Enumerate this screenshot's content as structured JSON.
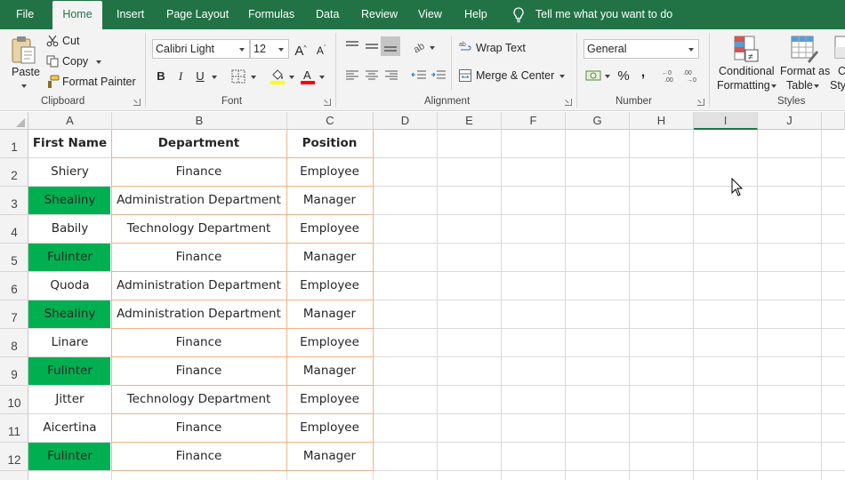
{
  "menu": {
    "tabs": [
      "File",
      "Home",
      "Insert",
      "Page Layout",
      "Formulas",
      "Data",
      "Review",
      "View",
      "Help"
    ],
    "active_tab": "Home",
    "tell_me": "Tell me what you want to do"
  },
  "ribbon": {
    "clipboard": {
      "paste": "Paste",
      "cut": "Cut",
      "copy": "Copy",
      "format_painter": "Format Painter",
      "label": "Clipboard"
    },
    "font": {
      "font_name": "Calibri Light",
      "font_size": "12",
      "bold": "B",
      "italic": "I",
      "underline": "U",
      "label": "Font",
      "highlight_color": "#ffff00",
      "font_color": "#ff0000"
    },
    "alignment": {
      "wrap_text": "Wrap Text",
      "merge_center": "Merge & Center",
      "label": "Alignment"
    },
    "number": {
      "format": "General",
      "percent": "%",
      "comma": ",",
      "label": "Number"
    },
    "styles": {
      "conditional_1": "Conditional",
      "conditional_2": "Formatting",
      "format_as_1": "Format as",
      "format_as_2": "Table",
      "cell_styles_1": "C",
      "cell_styles_2": "Sty",
      "label": "Styles"
    }
  },
  "grid": {
    "columns": [
      "A",
      "B",
      "C",
      "D",
      "E",
      "F",
      "G",
      "H",
      "I",
      "J"
    ],
    "selected_column": "I",
    "rows": [
      "1",
      "2",
      "3",
      "4",
      "5",
      "6",
      "7",
      "8",
      "9",
      "10",
      "11",
      "12"
    ],
    "headers": [
      "First Name",
      "Department",
      "Position"
    ],
    "records": [
      [
        "Shiery",
        "Finance",
        "Employee"
      ],
      [
        "Shealiny",
        "Administration Department",
        "Manager"
      ],
      [
        "Babily",
        "Technology Department",
        "Employee"
      ],
      [
        "Fulinter",
        "Finance",
        "Manager"
      ],
      [
        "Quoda",
        "Administration Department",
        "Employee"
      ],
      [
        "Shealiny",
        "Administration Department",
        "Manager"
      ],
      [
        "Linare",
        "Finance",
        "Employee"
      ],
      [
        "Fulinter",
        "Finance",
        "Manager"
      ],
      [
        "Jitter",
        "Technology Department",
        "Employee"
      ],
      [
        "Aicertina",
        "Finance",
        "Employee"
      ],
      [
        "Fulinter",
        "Finance",
        "Manager"
      ]
    ],
    "highlighted_rows": [
      3,
      5,
      7,
      9,
      12
    ],
    "highlight_color": "#00b050",
    "table_border_color": "#f4b183"
  },
  "colors": {
    "excel_green": "#217346"
  }
}
